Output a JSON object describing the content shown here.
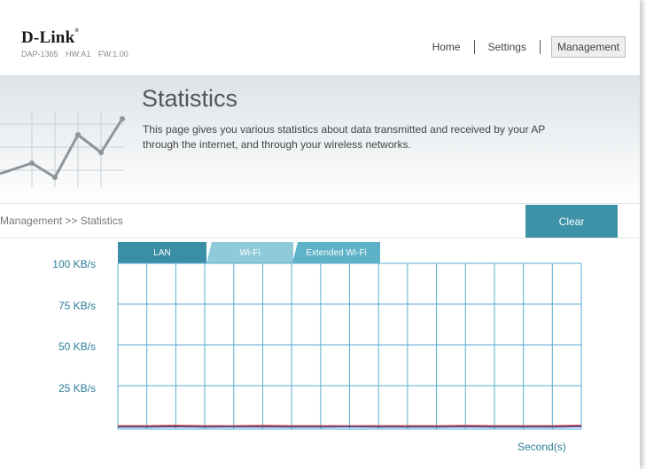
{
  "header": {
    "brand": "D-Link",
    "brand_mark": "®",
    "model": "DAP-1365",
    "hw": "HW:A1",
    "fw": "FW:1.00"
  },
  "nav": {
    "home": "Home",
    "settings": "Settings",
    "management": "Management"
  },
  "banner": {
    "title": "Statistics",
    "description": "This page gives you various statistics about data transmitted and received by your AP through the internet, and through your wireless networks.",
    "icon": "line-chart-icon"
  },
  "breadcrumb": "Management >> Statistics",
  "clear_label": "Clear",
  "tabs": {
    "lan": "LAN",
    "wifi": "Wi-Fi",
    "extended": "Extended Wi-Fi",
    "selected": "LAN"
  },
  "chart_data": {
    "type": "line",
    "y_tick_labels": [
      "100 KB/s",
      "75 KB/s",
      "50 KB/s",
      "25 KB/s"
    ],
    "ylim": [
      0,
      100
    ],
    "x_unit_label": "Second(s)",
    "grid": true,
    "x": [
      0,
      1,
      2,
      3,
      4,
      5,
      6,
      7,
      8,
      9,
      10,
      11,
      12,
      13,
      14,
      15,
      16
    ],
    "series": [
      {
        "color": "#d9342b",
        "values": [
          0.3,
          0.3,
          0.6,
          0.3,
          0.3,
          0.5,
          0.3,
          0.3,
          0.3,
          0.3,
          0.3,
          0.3,
          0.5,
          0.3,
          0.3,
          0.3,
          0.6
        ]
      },
      {
        "color": "#3b4ea0",
        "values": [
          0.2,
          0.2,
          0.4,
          0.2,
          0.3,
          0.3,
          0.2,
          0.2,
          0.4,
          0.2,
          0.2,
          0.2,
          0.4,
          0.2,
          0.2,
          0.2,
          0.5
        ]
      }
    ]
  },
  "colors": {
    "accent": "#3d92a8",
    "axis_text": "#2b7d99",
    "grid": "#5aaed0"
  }
}
